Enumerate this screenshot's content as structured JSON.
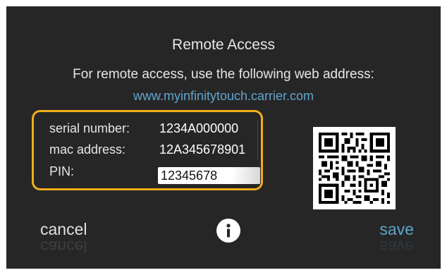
{
  "screen": {
    "title": "Remote Access",
    "instructions": "For remote access, use the following web address:",
    "web_address": "www.myinfinitytouch.carrier.com"
  },
  "device_info": {
    "serial_label": "serial number:",
    "serial_value": "1234A000000",
    "mac_label": "mac address:",
    "mac_value": "12A345678901",
    "pin_label": "PIN:",
    "pin_value": "12345678"
  },
  "qr_code": {
    "icon": "qr-code"
  },
  "actions": {
    "cancel_label": "cancel",
    "save_label": "save",
    "info_icon": "info-icon"
  },
  "colors": {
    "background": "#262626",
    "highlight_border": "#f2ad1b",
    "link": "#5ea6cc",
    "save": "#5ea6cc"
  }
}
